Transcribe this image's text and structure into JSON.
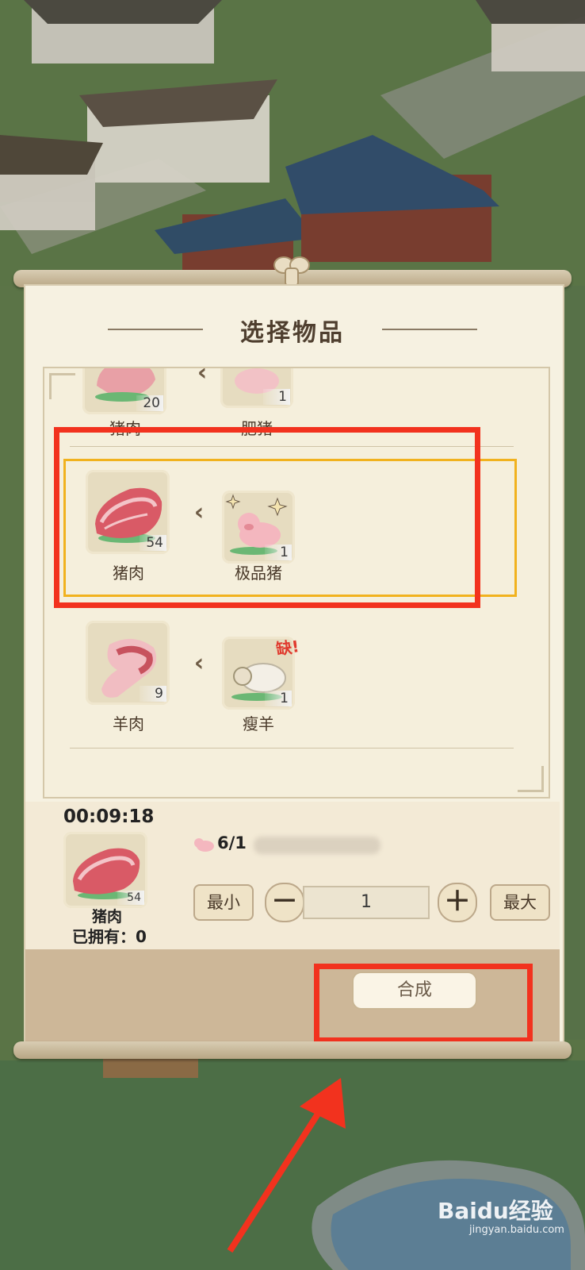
{
  "dialog": {
    "title": "选择物品"
  },
  "recipes": [
    {
      "product": {
        "name": "猪肉",
        "count": "20"
      },
      "ingredient": {
        "name": "肥猪",
        "count": "1"
      }
    },
    {
      "product": {
        "name": "猪肉",
        "count": "54"
      },
      "ingredient": {
        "name": "极品猪",
        "count": "1"
      }
    },
    {
      "product": {
        "name": "羊肉",
        "count": "9"
      },
      "ingredient": {
        "name": "瘦羊",
        "count": "1",
        "badge": "缺!"
      }
    }
  ],
  "craft": {
    "timer": "00:09:18",
    "item_name": "猪肉",
    "item_count": "54",
    "owned_label": "已拥有：0",
    "requirement": "6/1",
    "min_label": "最小",
    "max_label": "最大",
    "minus": "－",
    "plus": "＋",
    "quantity": "1",
    "synth_label": "合成"
  },
  "watermark": {
    "brand": "Baidu经验",
    "url": "jingyan.baidu.com"
  },
  "colors": {
    "highlight_red": "#f2321e",
    "selected_gold": "#f1b21e"
  }
}
